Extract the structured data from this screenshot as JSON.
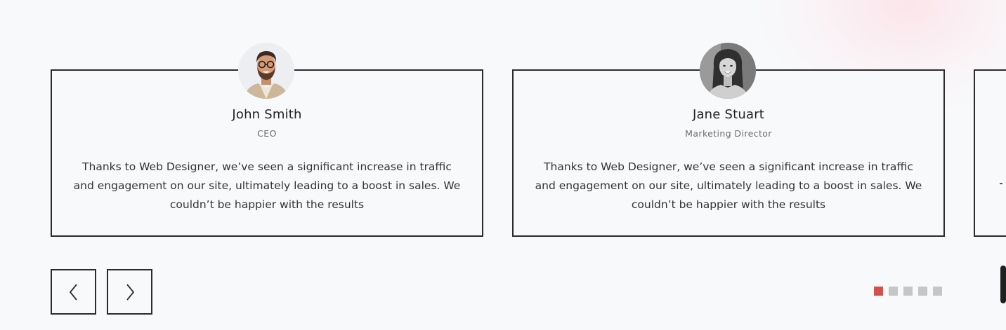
{
  "testimonials": [
    {
      "name": "John Smith",
      "role": "CEO",
      "quote": "Thanks to Web Designer, we’ve seen a significant increase in traffic and engagement on our site, ultimately leading to a boost in sales. We couldn’t be happier with the results",
      "avatar_icon": "man-portrait-photo"
    },
    {
      "name": "Jane Stuart",
      "role": "Marketing Director",
      "quote": "Thanks to Web Designer, we’ve seen a significant increase in traffic and engagement on our site, ultimately leading to a boost in sales. We couldn’t be happier with the results",
      "avatar_icon": "woman-portrait-photo"
    }
  ],
  "navigation": {
    "prev_icon": "chevron-left-icon",
    "next_icon": "chevron-right-icon"
  },
  "pagination": {
    "total": 5,
    "active_index": 0,
    "active_color": "#d4504c",
    "inactive_color": "#c6c6c6"
  },
  "colors": {
    "background": "#f8f9fb",
    "border": "#2b2b2b",
    "text": "#222222",
    "muted_text": "#6c6c6c"
  }
}
